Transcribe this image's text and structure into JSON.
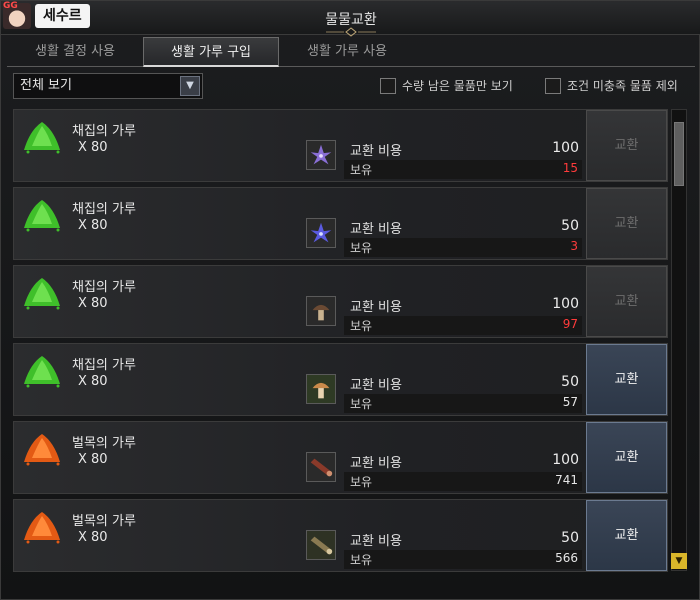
{
  "window": {
    "title": "물물교환"
  },
  "user": {
    "badge": "GG",
    "name": "세수르"
  },
  "tabs": [
    {
      "label": "생활 결정 사용",
      "active": false
    },
    {
      "label": "생활 가루 구입",
      "active": true
    },
    {
      "label": "생활 가루 사용",
      "active": false
    }
  ],
  "filter": {
    "dropdown_value": "전체 보기",
    "only_remaining": "수량 남은 물품만 보기",
    "exclude_unmet": "조건 미충족 물품 제외"
  },
  "cost_label": "교환 비용",
  "own_label": "보유",
  "button_label": "교환",
  "colors": {
    "green_powder": "#3fbf2a",
    "orange_powder": "#e35a14",
    "enabled_button": "#3a4556",
    "low_stock": "#ff3b3b"
  },
  "rows": [
    {
      "name": "채집의 가루",
      "qty": "X 80",
      "reward_icon": "green-powder-icon",
      "cost_icon": "purple-flower-icon",
      "cost": "100",
      "own": "15",
      "sufficient": false
    },
    {
      "name": "채집의 가루",
      "qty": "X 80",
      "reward_icon": "green-powder-icon",
      "cost_icon": "blue-flower-icon",
      "cost": "50",
      "own": "3",
      "sufficient": false
    },
    {
      "name": "채집의 가루",
      "qty": "X 80",
      "reward_icon": "green-powder-icon",
      "cost_icon": "brown-mushroom-icon",
      "cost": "100",
      "own": "97",
      "sufficient": false
    },
    {
      "name": "채집의 가루",
      "qty": "X 80",
      "reward_icon": "green-powder-icon",
      "cost_icon": "orange-mushroom-icon",
      "cost": "50",
      "own": "57",
      "sufficient": true
    },
    {
      "name": "벌목의 가루",
      "qty": "X 80",
      "reward_icon": "orange-powder-icon",
      "cost_icon": "red-log-icon",
      "cost": "100",
      "own": "741",
      "sufficient": true
    },
    {
      "name": "벌목의 가루",
      "qty": "X 80",
      "reward_icon": "orange-powder-icon",
      "cost_icon": "brown-log-icon",
      "cost": "50",
      "own": "566",
      "sufficient": true
    }
  ]
}
